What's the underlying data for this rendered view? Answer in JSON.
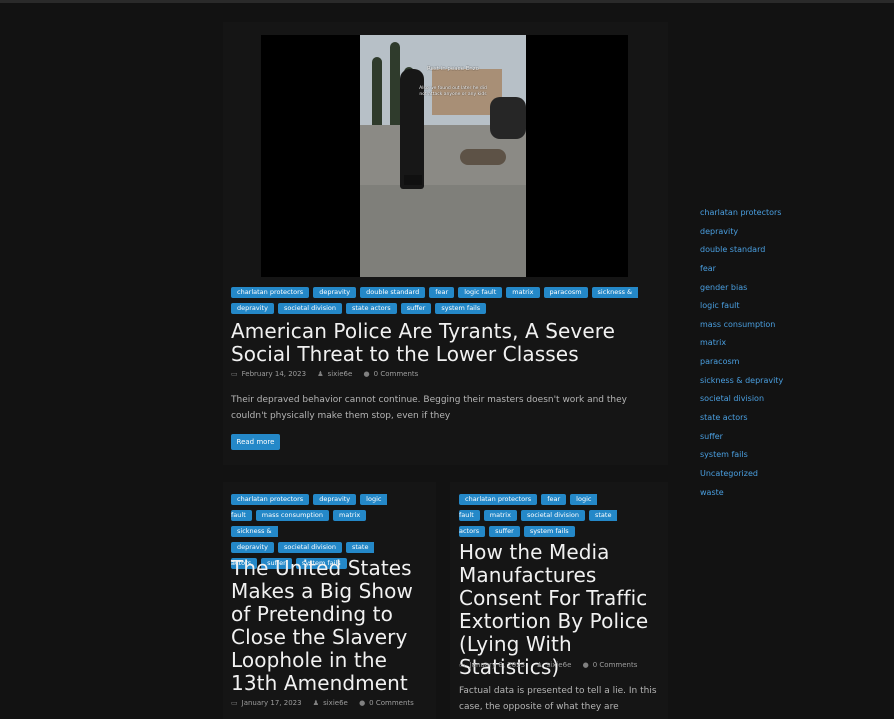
{
  "featured": {
    "video_caption": "Rest in peace Enzo",
    "video_caption_sub": "Also we found out later he did not attack anyone or any kids",
    "tags": [
      "charlatan protectors",
      "depravity",
      "double standard",
      "fear",
      "logic fault",
      "matrix",
      "paracosm",
      "sickness &",
      "depravity",
      "societal division",
      "state actors",
      "suffer",
      "system fails"
    ],
    "title": "American Police Are Tyrants, A Severe Social Threat to the Lower Classes",
    "date": "February 14, 2023",
    "author": "sixie6e",
    "comments": "0 Comments",
    "excerpt": "Their depraved behavior cannot continue. Begging their masters doesn't work and they couldn't physically make them stop, even if they",
    "read_more": "Read more"
  },
  "post2": {
    "tags": [
      "charlatan protectors",
      "depravity",
      "logic",
      "fault",
      "mass consumption",
      "matrix",
      "sickness &",
      "depravity",
      "societal division",
      "state",
      "actors",
      "suffer",
      "system fails"
    ],
    "title": "The United States Makes a Big Show of Pretending to Close the Slavery Loophole in the 13th Amendment",
    "date": "January 17, 2023",
    "author": "sixie6e",
    "comments": "0 Comments"
  },
  "post3": {
    "tags": [
      "charlatan protectors",
      "fear",
      "logic",
      "fault",
      "matrix",
      "societal division",
      "state",
      "actors",
      "suffer",
      "system fails"
    ],
    "title": "How the Media Manufactures Consent For Traffic Extortion By Police (Lying With Statistics)",
    "date": "January 8, 2023",
    "author": "sixie6e",
    "comments": "0 Comments",
    "excerpt": "Factual data is presented to tell a lie. In this case, the opposite of what they are"
  },
  "sidebar": {
    "categories": [
      "charlatan protectors",
      "depravity",
      "double standard",
      "fear",
      "gender bias",
      "logic fault",
      "mass consumption",
      "matrix",
      "paracosm",
      "sickness & depravity",
      "societal division",
      "state actors",
      "suffer",
      "system fails",
      "Uncategorized",
      "waste"
    ]
  },
  "icons": {
    "date": "calendar-icon",
    "author": "user-icon",
    "comments": "comment-icon"
  },
  "colors": {
    "background": "#121212",
    "accent": "#2488c8",
    "link": "#4a9fe0"
  }
}
